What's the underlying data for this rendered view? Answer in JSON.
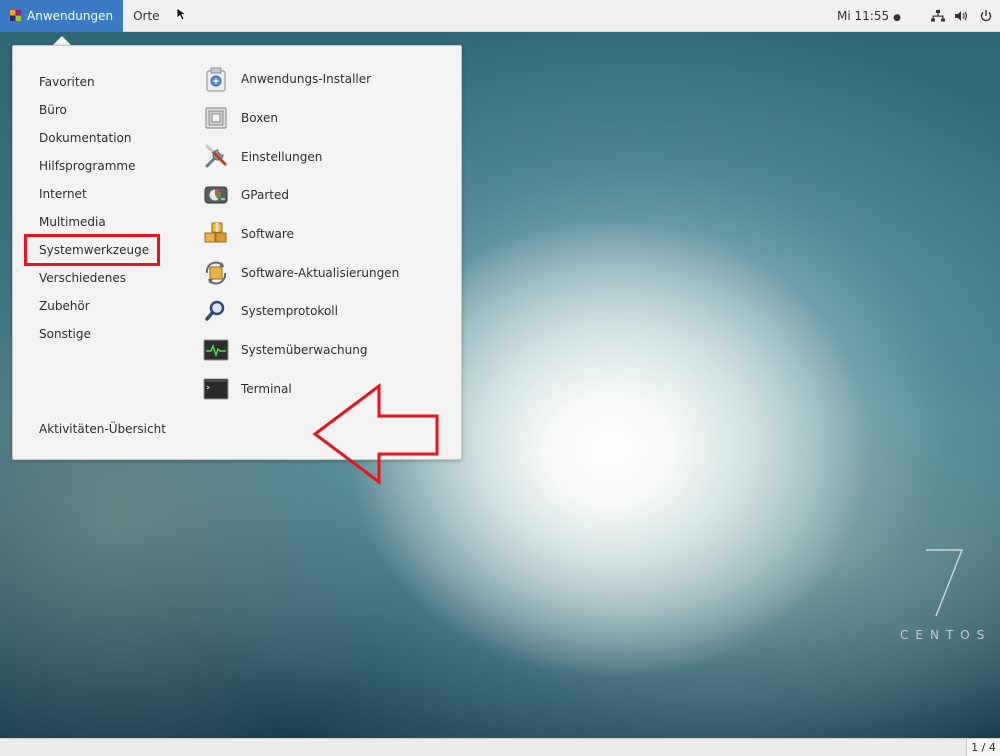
{
  "topbar": {
    "applications_label": "Anwendungen",
    "places_label": "Orte",
    "clock": "Mi 11:55",
    "clock_indicator": "●"
  },
  "menu": {
    "categories": [
      {
        "label": "Favoriten"
      },
      {
        "label": "Büro"
      },
      {
        "label": "Dokumentation"
      },
      {
        "label": "Hilfsprogramme"
      },
      {
        "label": "Internet"
      },
      {
        "label": "Multimedia"
      },
      {
        "label": "Systemwerkzeuge",
        "highlighted": true
      },
      {
        "label": "Verschiedenes"
      },
      {
        "label": "Zubehör"
      },
      {
        "label": "Sonstige"
      }
    ],
    "overview_label": "Aktivitäten-Übersicht",
    "apps": [
      {
        "label": "Anwendungs-Installer",
        "icon": "package-installer-icon"
      },
      {
        "label": "Boxen",
        "icon": "boxes-icon"
      },
      {
        "label": "Einstellungen",
        "icon": "settings-tools-icon"
      },
      {
        "label": "GParted",
        "icon": "gparted-disk-icon"
      },
      {
        "label": "Software",
        "icon": "software-packages-icon"
      },
      {
        "label": "Software-Aktualisierungen",
        "icon": "software-update-icon"
      },
      {
        "label": "Systemprotokoll",
        "icon": "log-magnifier-icon"
      },
      {
        "label": "Systemüberwachung",
        "icon": "system-monitor-icon"
      },
      {
        "label": "Terminal",
        "icon": "terminal-icon"
      }
    ]
  },
  "branding": {
    "version": "7",
    "name": "CENTOS"
  },
  "bottombar": {
    "workspace_indicator": "1 / 4"
  },
  "colors": {
    "accent": "#3b7ac4",
    "annotation_red": "#e8141e"
  }
}
